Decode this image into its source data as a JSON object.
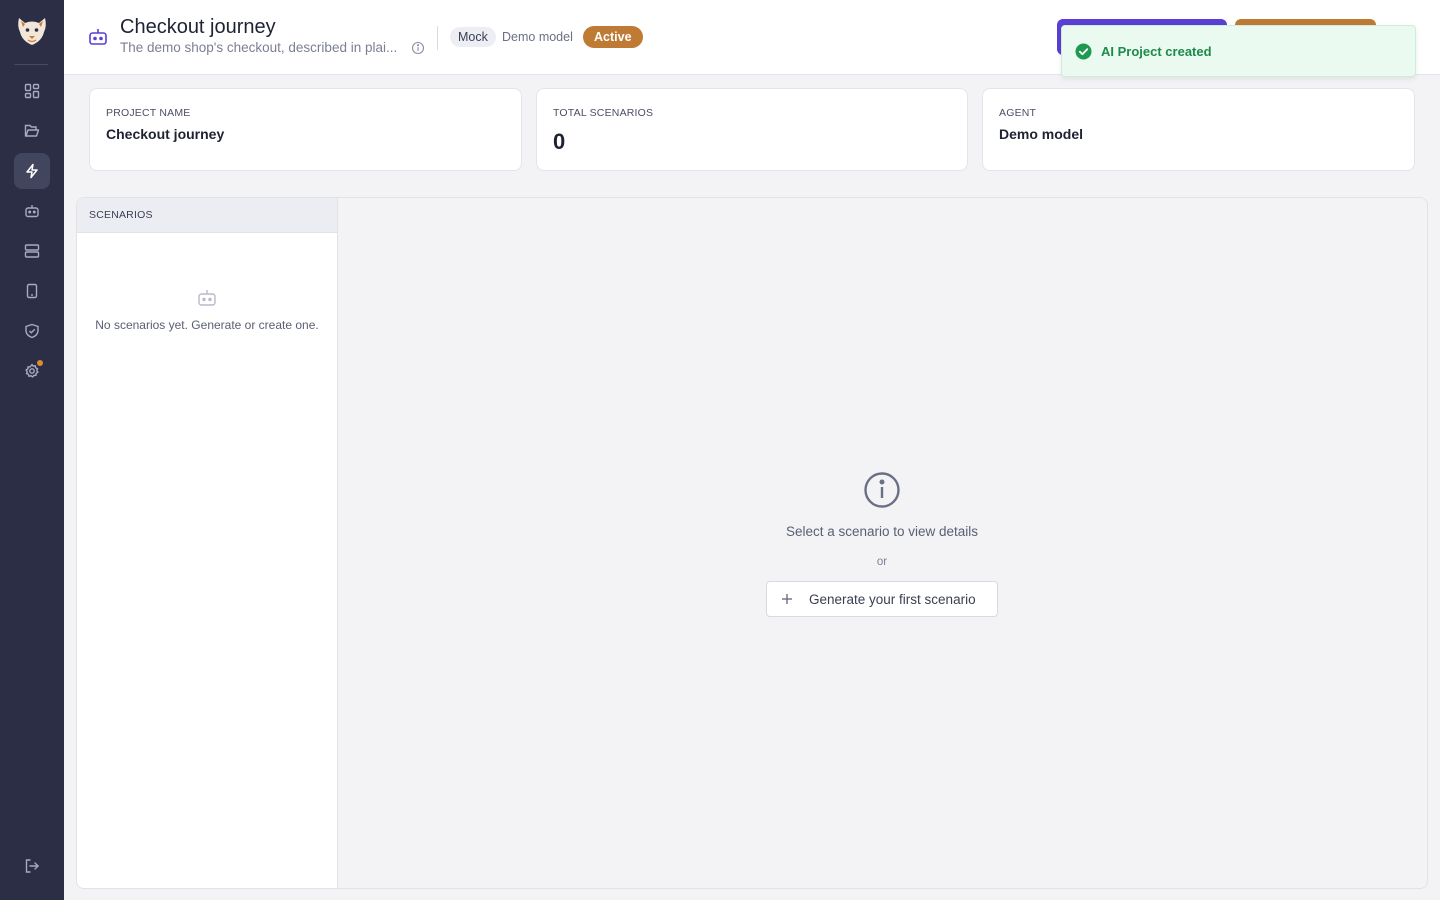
{
  "sidebar": {
    "items": [
      {
        "name": "dashboard",
        "icon": "grid-icon"
      },
      {
        "name": "folders",
        "icon": "folder-icon"
      },
      {
        "name": "runs",
        "icon": "lightning-icon",
        "active": true
      },
      {
        "name": "agents",
        "icon": "bot-icon"
      },
      {
        "name": "servers",
        "icon": "server-icon"
      },
      {
        "name": "devices",
        "icon": "phone-icon"
      },
      {
        "name": "security",
        "icon": "shield-icon"
      },
      {
        "name": "settings",
        "icon": "gear-icon",
        "notification": true
      }
    ],
    "logout_icon": "logout-icon"
  },
  "header": {
    "title": "Checkout journey",
    "subtitle": "The demo shop's checkout, described in plai...",
    "mode_tag": "Mock",
    "model": "Demo model",
    "status": "Active"
  },
  "toast": {
    "message": "AI Project created"
  },
  "cards": [
    {
      "label": "PROJECT NAME",
      "value": "Checkout journey"
    },
    {
      "label": "TOTAL SCENARIOS",
      "value": "0"
    },
    {
      "label": "AGENT",
      "value": "Demo model"
    }
  ],
  "scenarios": {
    "heading": "SCENARIOS",
    "empty_text": "No scenarios yet. Generate or create one."
  },
  "detail": {
    "message": "Select a scenario to view details",
    "or": "or",
    "generate_label": "Generate your first scenario"
  },
  "colors": {
    "sidebar": "#2b2e44",
    "accent_purple": "#5a3fd4",
    "accent_orange": "#bf7a34",
    "success": "#1d8a4a"
  }
}
